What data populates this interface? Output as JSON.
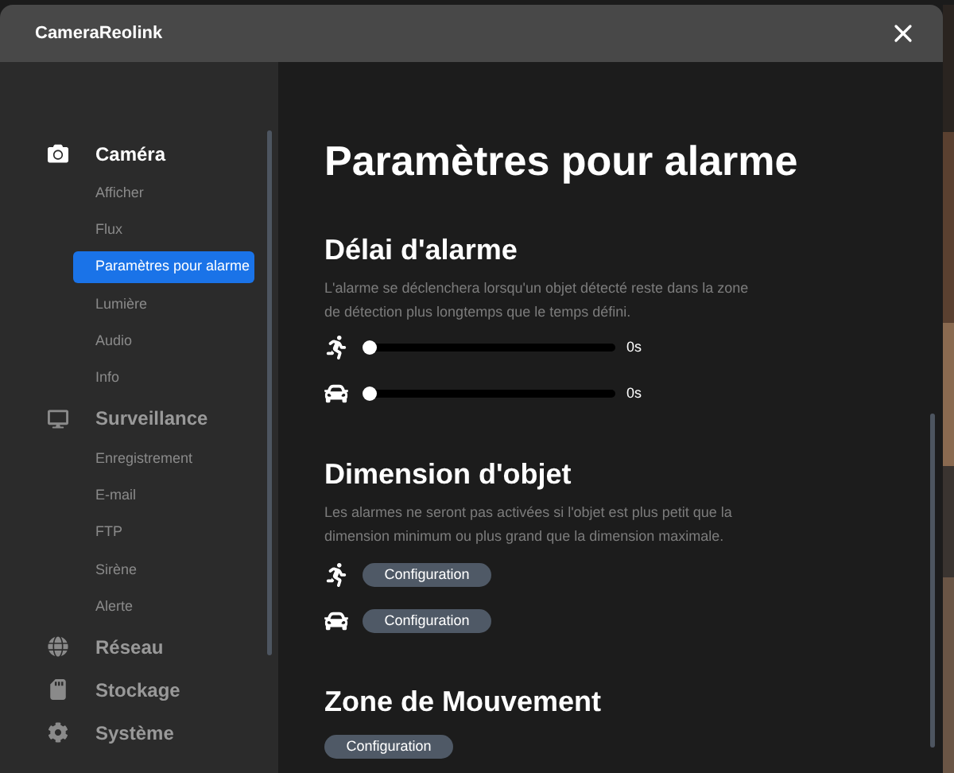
{
  "window": {
    "title": "CameraReolink"
  },
  "sidebar": {
    "sections": [
      {
        "label": "Caméra",
        "active": true,
        "items": [
          {
            "label": "Afficher",
            "selected": false
          },
          {
            "label": "Flux",
            "selected": false
          },
          {
            "label": "Paramètres pour alarme",
            "selected": true
          },
          {
            "label": "Lumière",
            "selected": false
          },
          {
            "label": "Audio",
            "selected": false
          },
          {
            "label": "Info",
            "selected": false
          }
        ]
      },
      {
        "label": "Surveillance",
        "active": false,
        "items": [
          {
            "label": "Enregistrement",
            "selected": false
          },
          {
            "label": "E-mail",
            "selected": false
          },
          {
            "label": "FTP",
            "selected": false
          },
          {
            "label": "Sirène",
            "selected": false
          },
          {
            "label": "Alerte",
            "selected": false
          }
        ]
      },
      {
        "label": "Réseau",
        "active": false
      },
      {
        "label": "Stockage",
        "active": false
      },
      {
        "label": "Système",
        "active": false
      }
    ]
  },
  "page": {
    "title": "Paramètres pour alarme",
    "sections": [
      {
        "kind": "sliders",
        "title": "Délai d'alarme",
        "description": "L'alarme se déclenchera lorsqu'un objet détecté reste dans la zone de détection plus longtemps que le temps défini.",
        "rows": [
          {
            "level": 0,
            "reading": "0s"
          },
          {
            "level": 0,
            "reading": "0s"
          }
        ]
      },
      {
        "kind": "buttons",
        "title": "Dimension d'objet",
        "description": "Les alarmes ne seront pas activées si l'objet est plus petit que la dimension minimum ou plus grand que la dimension maximale.",
        "rows": [
          {
            "button": "Configuration"
          },
          {
            "button": "Configuration"
          }
        ]
      },
      {
        "kind": "button",
        "title": "Zone de Mouvement",
        "button": "Configuration"
      }
    ]
  }
}
